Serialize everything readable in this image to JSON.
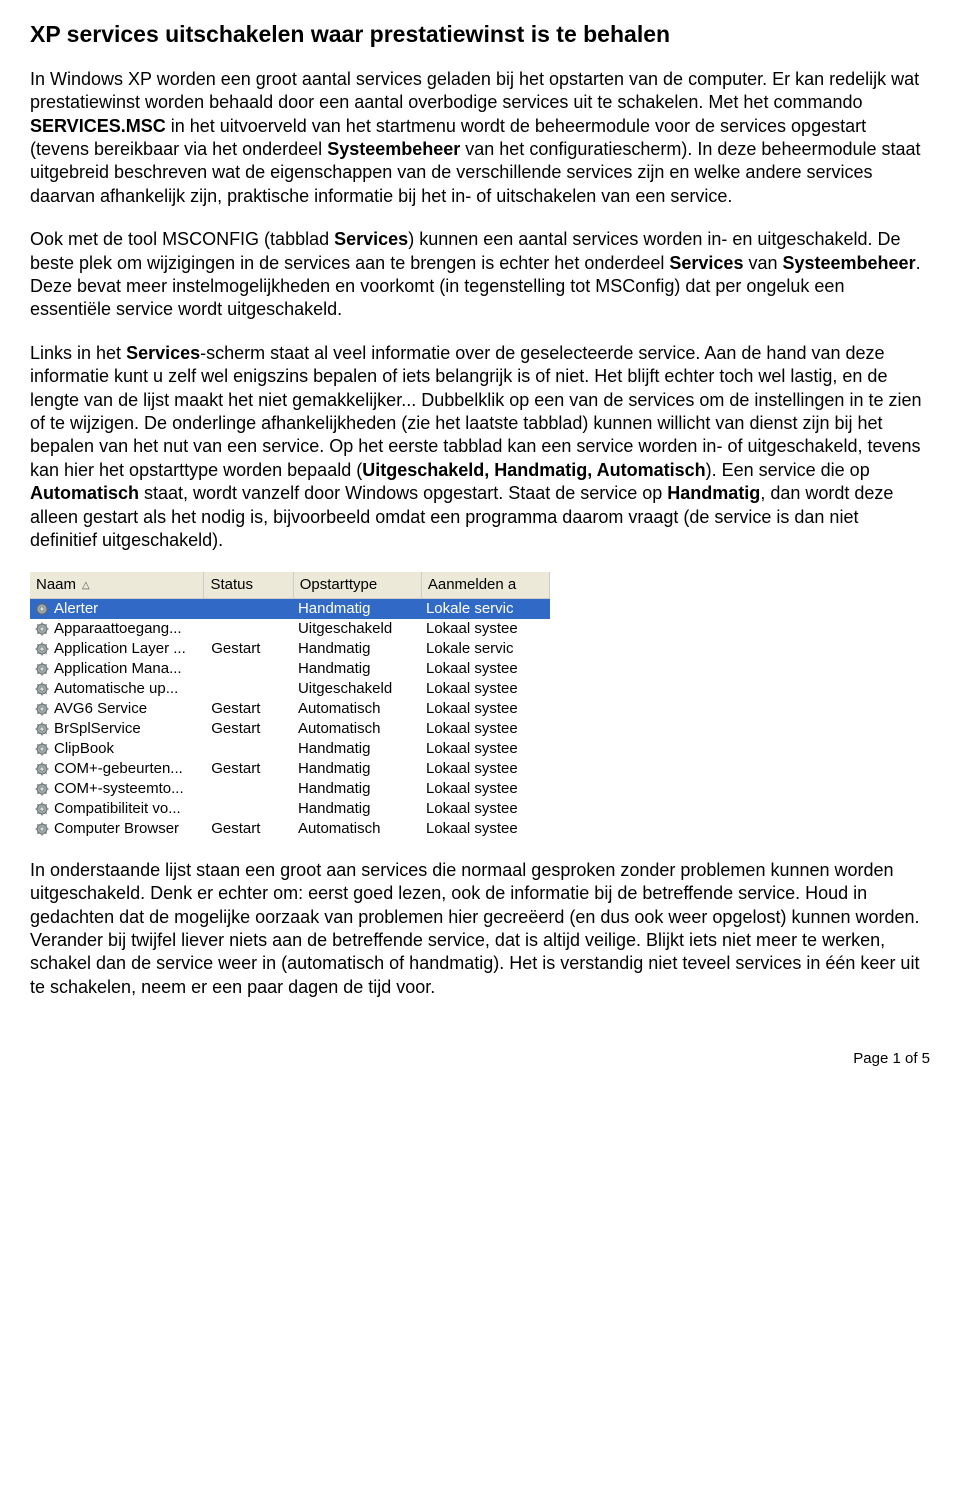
{
  "title": "XP services uitschakelen waar prestatiewinst is te behalen",
  "para1_a": "In Windows XP worden een groot aantal services geladen bij het opstarten van de computer. Er kan redelijk wat prestatiewinst worden behaald door een aantal overbodige services uit te schakelen. Met het commando ",
  "para1_b": "SERVICES.MSC",
  "para1_c": " in het uitvoerveld van het startmenu wordt de beheermodule voor de services opgestart (tevens bereikbaar via het onderdeel ",
  "para1_d": "Systeembeheer",
  "para1_e": " van het configuratiescherm). In deze beheermodule staat uitgebreid beschreven wat de eigenschappen van de verschillende services zijn en welke andere services daarvan afhankelijk zijn, praktische informatie bij het in- of uitschakelen van een service.",
  "para2_a": "Ook met de tool MSCONFIG (tabblad ",
  "para2_b": "Services",
  "para2_c": ") kunnen een aantal services worden in- en uitgeschakeld. De beste plek om wijzigingen in de services aan te brengen is echter het onderdeel ",
  "para2_d": "Services",
  "para2_e": " van ",
  "para2_f": "Systeembeheer",
  "para2_g": ". Deze bevat meer instelmogelijkheden en voorkomt (in tegenstelling tot MSConfig) dat per ongeluk een essentiële service wordt uitgeschakeld.",
  "para3_a": "Links in het ",
  "para3_b": "Services",
  "para3_c": "-scherm staat al veel informatie over de geselecteerde service. Aan de hand van deze informatie kunt u zelf wel enigszins bepalen of iets belangrijk is of niet. Het blijft echter toch wel lastig, en de lengte van de lijst maakt het niet gemakkelijker... Dubbelklik op een van de services om de instellingen in te zien of te wijzigen. De onderlinge afhankelijkheden (zie het laatste tabblad) kunnen willicht van dienst zijn bij het bepalen van het nut van een service. Op het eerste tabblad kan een service worden in- of uitgeschakeld, tevens kan hier het opstarttype worden bepaald (",
  "para3_d": "Uitgeschakeld, Handmatig, Automatisch",
  "para3_e": "). Een service die op ",
  "para3_f": "Automatisch",
  "para3_g": " staat, wordt vanzelf door Windows opgestart. Staat de service op ",
  "para3_h": "Handmatig",
  "para3_i": ", dan wordt deze alleen gestart als het nodig is, bijvoorbeeld omdat een programma daarom vraagt (de service is dan niet definitief uitgeschakeld).",
  "para4": "In onderstaande lijst staan een groot aan services die normaal gesproken zonder problemen kunnen worden uitgeschakeld. Denk er echter om: eerst goed lezen, ook de informatie bij de betreffende service. Houd in gedachten dat de mogelijke oorzaak van problemen hier gecreëerd (en dus ook weer opgelost) kunnen worden. Verander bij twijfel liever niets aan de betreffende service, dat is altijd veilige. Blijkt iets niet meer te werken, schakel dan de service weer in (automatisch of handmatig). Het is verstandig niet teveel services in één keer uit te schakelen, neem er een paar dagen de tijd voor.",
  "footer": "Page 1 of 5",
  "table": {
    "headers": {
      "name": "Naam",
      "status": "Status",
      "type": "Opstarttype",
      "logon": "Aanmelden a"
    },
    "rows": [
      {
        "name": "Alerter",
        "status": "",
        "type": "Handmatig",
        "logon": "Lokale servic",
        "selected": true
      },
      {
        "name": "Apparaattoegang...",
        "status": "",
        "type": "Uitgeschakeld",
        "logon": "Lokaal systee"
      },
      {
        "name": "Application Layer ...",
        "status": "Gestart",
        "type": "Handmatig",
        "logon": "Lokale servic"
      },
      {
        "name": "Application Mana...",
        "status": "",
        "type": "Handmatig",
        "logon": "Lokaal systee"
      },
      {
        "name": "Automatische up...",
        "status": "",
        "type": "Uitgeschakeld",
        "logon": "Lokaal systee"
      },
      {
        "name": "AVG6 Service",
        "status": "Gestart",
        "type": "Automatisch",
        "logon": "Lokaal systee"
      },
      {
        "name": "BrSplService",
        "status": "Gestart",
        "type": "Automatisch",
        "logon": "Lokaal systee"
      },
      {
        "name": "ClipBook",
        "status": "",
        "type": "Handmatig",
        "logon": "Lokaal systee"
      },
      {
        "name": "COM+-gebeurten...",
        "status": "Gestart",
        "type": "Handmatig",
        "logon": "Lokaal systee"
      },
      {
        "name": "COM+-systeemto...",
        "status": "",
        "type": "Handmatig",
        "logon": "Lokaal systee"
      },
      {
        "name": "Compatibiliteit vo...",
        "status": "",
        "type": "Handmatig",
        "logon": "Lokaal systee"
      },
      {
        "name": "Computer Browser",
        "status": "Gestart",
        "type": "Automatisch",
        "logon": "Lokaal systee"
      }
    ]
  }
}
